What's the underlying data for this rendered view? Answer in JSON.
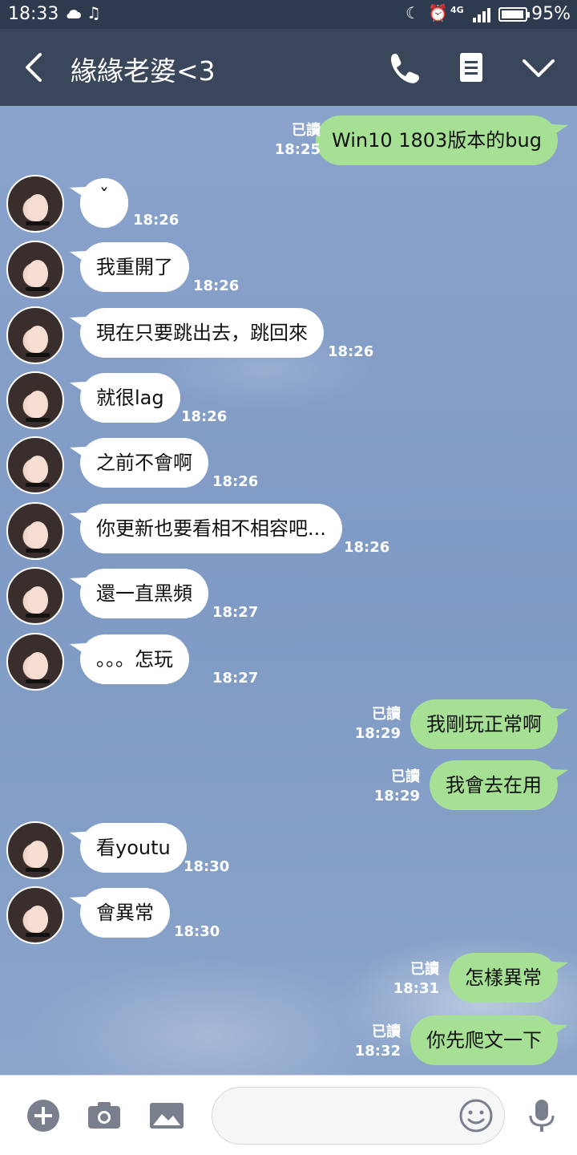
{
  "status_bar": {
    "time": "18:33",
    "network": "4G",
    "battery": "95%"
  },
  "header": {
    "title": "緣緣老婆<3"
  },
  "messages": [
    {
      "side": "out",
      "text": "Win10  1803版本的bug",
      "read": "已讀",
      "time": "18:25"
    },
    {
      "side": "in",
      "text": "ˇ",
      "time": "18:26"
    },
    {
      "side": "in",
      "text": "我重開了",
      "time": "18:26"
    },
    {
      "side": "in",
      "text": "現在只要跳出去，跳回來",
      "time": "18:26"
    },
    {
      "side": "in",
      "text": "就很lag",
      "time": "18:26"
    },
    {
      "side": "in",
      "text": "之前不會啊",
      "time": "18:26"
    },
    {
      "side": "in",
      "text": "你更新也要看相不相容吧...",
      "time": "18:26"
    },
    {
      "side": "in",
      "text": "還一直黑頻",
      "time": "18:27"
    },
    {
      "side": "in",
      "text": "。。。怎玩",
      "time": "18:27"
    },
    {
      "side": "out",
      "text": "我剛玩正常啊",
      "read": "已讀",
      "time": "18:29"
    },
    {
      "side": "out",
      "text": "我會去在用",
      "read": "已讀",
      "time": "18:29"
    },
    {
      "side": "in",
      "text": "看youtu",
      "time": "18:30"
    },
    {
      "side": "in",
      "text": "會異常",
      "time": "18:30"
    },
    {
      "side": "out",
      "text": "怎樣異常",
      "read": "已讀",
      "time": "18:31"
    },
    {
      "side": "out",
      "text": "你先爬文一下",
      "read": "已讀",
      "time": "18:32"
    }
  ],
  "colors": {
    "header_bg": "#3a4659",
    "status_bg": "#2e3a4e",
    "outgoing_bubble": "#a6e094",
    "incoming_bubble": "#ffffff",
    "chat_bg": "#7f9ac4"
  },
  "icons": {
    "back": "chevron-left-icon",
    "call": "phone-icon",
    "notes": "notes-icon",
    "menu": "chevron-down-icon",
    "add": "plus-circle-icon",
    "camera": "camera-icon",
    "gallery": "image-icon",
    "emoji": "smiley-icon",
    "voice": "microphone-icon"
  }
}
